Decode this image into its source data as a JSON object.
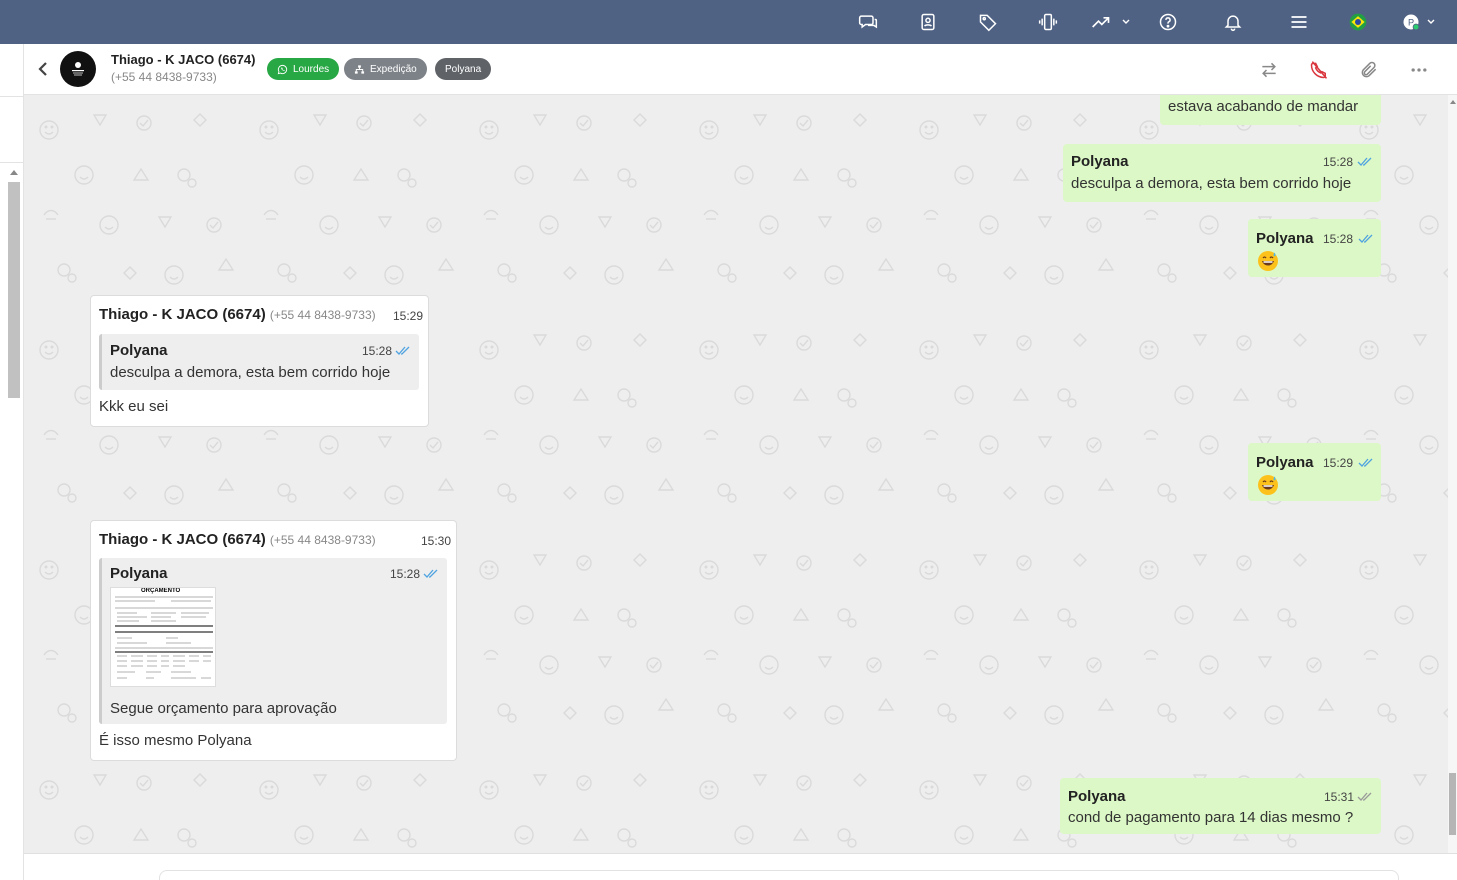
{
  "topbar": {
    "icons": [
      "chat-bubbles-icon",
      "contact-card-icon",
      "tag-icon",
      "vibrate-phone-icon",
      "trending-up-icon",
      "help-circle-icon",
      "bell-icon",
      "menu-icon",
      "brazil-flag-icon",
      "user-avatar-icon"
    ],
    "user_initial": "P",
    "colors": {
      "bar": "#4f6283",
      "online": "#2ecc71"
    }
  },
  "header": {
    "contact_name": "Thiago - K JACO (6674)",
    "contact_phone": "(+55 44 8438-9733)",
    "tags": [
      {
        "label": "Lourdes",
        "icon": "whatsapp-icon",
        "color": "#28a745"
      },
      {
        "label": "Expedição",
        "icon": "sitemap-icon",
        "color": "#7d8288"
      },
      {
        "label": "Polyana",
        "color": "#5f6368"
      }
    ],
    "actions": [
      "transfer-icon",
      "end-call-icon",
      "attach-icon",
      "more-icon"
    ]
  },
  "messages": [
    {
      "type": "outgoing",
      "text": "estava acabando de mandar"
    },
    {
      "type": "outgoing",
      "sender": "Polyana",
      "time": "15:28",
      "text": "desculpa a demora, esta bem corrido hoje",
      "status": "read"
    },
    {
      "type": "outgoing",
      "sender": "Polyana",
      "time": "15:28",
      "emoji": "grinning-sweat-emoji",
      "status": "read"
    },
    {
      "type": "incoming",
      "sender": "Thiago - K JACO (6674)",
      "phone": "(+55 44 8438-9733)",
      "time": "15:29",
      "quote": {
        "sender": "Polyana",
        "time": "15:28",
        "text": "desculpa a demora, esta bem corrido hoje"
      },
      "text": "Kkk eu sei"
    },
    {
      "type": "outgoing",
      "sender": "Polyana",
      "time": "15:29",
      "emoji": "grinning-sweat-emoji",
      "status": "read"
    },
    {
      "type": "incoming",
      "sender": "Thiago - K JACO (6674)",
      "phone": "(+55 44 8438-9733)",
      "time": "15:30",
      "quote": {
        "sender": "Polyana",
        "time": "15:28",
        "image_title": "ORÇAMENTO",
        "text": "Segue orçamento para aprovação"
      },
      "text": "É isso mesmo Polyana"
    },
    {
      "type": "outgoing",
      "sender": "Polyana",
      "time": "15:31",
      "text": "cond de pagamento para 14 dias mesmo ?",
      "status": "delivered"
    }
  ],
  "colors": {
    "outgoing_bubble": "#dcf8c6",
    "incoming_bubble": "#ffffff",
    "chat_bg": "#eeeeee",
    "read_check": "#4fa3e0",
    "delivered_check": "#999999"
  }
}
